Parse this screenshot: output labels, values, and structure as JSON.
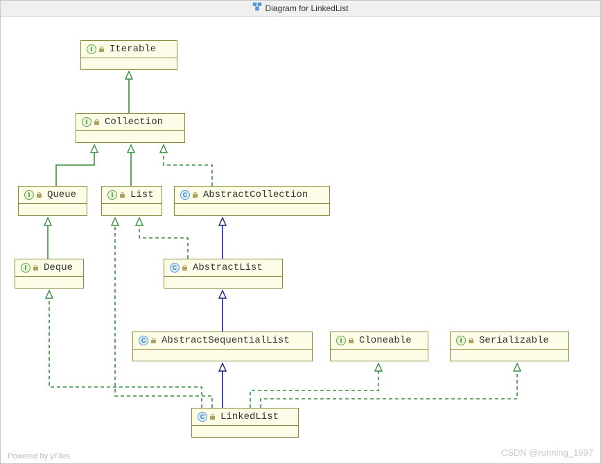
{
  "window": {
    "title": "Diagram for LinkedList"
  },
  "footer": {
    "left": "Powered by yFiles",
    "right": "CSDN @running_1997"
  },
  "nodes": {
    "iterable": {
      "label": "Iterable",
      "stereotype": "I"
    },
    "collection": {
      "label": "Collection",
      "stereotype": "I"
    },
    "queue": {
      "label": "Queue",
      "stereotype": "I"
    },
    "list": {
      "label": "List",
      "stereotype": "I"
    },
    "abscol": {
      "label": "AbstractCollection",
      "stereotype": "C"
    },
    "deque": {
      "label": "Deque",
      "stereotype": "I"
    },
    "abslist": {
      "label": "AbstractList",
      "stereotype": "C"
    },
    "absseqlist": {
      "label": "AbstractSequentialList",
      "stereotype": "C"
    },
    "cloneable": {
      "label": "Cloneable",
      "stereotype": "I"
    },
    "serializable": {
      "label": "Serializable",
      "stereotype": "I"
    },
    "linkedlist": {
      "label": "LinkedList",
      "stereotype": "C"
    }
  },
  "stereotype_glyph": {
    "I": "I",
    "C": "C"
  },
  "colors": {
    "realization": "#388e3c",
    "generalization": "#1a237e",
    "box_bg": "#fdfce6",
    "box_border": "#8a8a3a"
  },
  "chart_data": {
    "type": "uml-class-diagram",
    "nodes": [
      {
        "id": "Iterable",
        "kind": "interface"
      },
      {
        "id": "Collection",
        "kind": "interface"
      },
      {
        "id": "Queue",
        "kind": "interface"
      },
      {
        "id": "List",
        "kind": "interface"
      },
      {
        "id": "AbstractCollection",
        "kind": "abstract-class"
      },
      {
        "id": "Deque",
        "kind": "interface"
      },
      {
        "id": "AbstractList",
        "kind": "abstract-class"
      },
      {
        "id": "AbstractSequentialList",
        "kind": "abstract-class"
      },
      {
        "id": "Cloneable",
        "kind": "interface"
      },
      {
        "id": "Serializable",
        "kind": "interface"
      },
      {
        "id": "LinkedList",
        "kind": "class"
      }
    ],
    "edges": [
      {
        "from": "Collection",
        "to": "Iterable",
        "rel": "extends"
      },
      {
        "from": "Queue",
        "to": "Collection",
        "rel": "extends"
      },
      {
        "from": "List",
        "to": "Collection",
        "rel": "extends"
      },
      {
        "from": "AbstractCollection",
        "to": "Collection",
        "rel": "implements"
      },
      {
        "from": "Deque",
        "to": "Queue",
        "rel": "extends"
      },
      {
        "from": "AbstractList",
        "to": "AbstractCollection",
        "rel": "extends"
      },
      {
        "from": "AbstractList",
        "to": "List",
        "rel": "implements"
      },
      {
        "from": "AbstractSequentialList",
        "to": "AbstractList",
        "rel": "extends"
      },
      {
        "from": "LinkedList",
        "to": "AbstractSequentialList",
        "rel": "extends"
      },
      {
        "from": "LinkedList",
        "to": "Deque",
        "rel": "implements"
      },
      {
        "from": "LinkedList",
        "to": "List",
        "rel": "implements"
      },
      {
        "from": "LinkedList",
        "to": "Cloneable",
        "rel": "implements"
      },
      {
        "from": "LinkedList",
        "to": "Serializable",
        "rel": "implements"
      }
    ]
  }
}
